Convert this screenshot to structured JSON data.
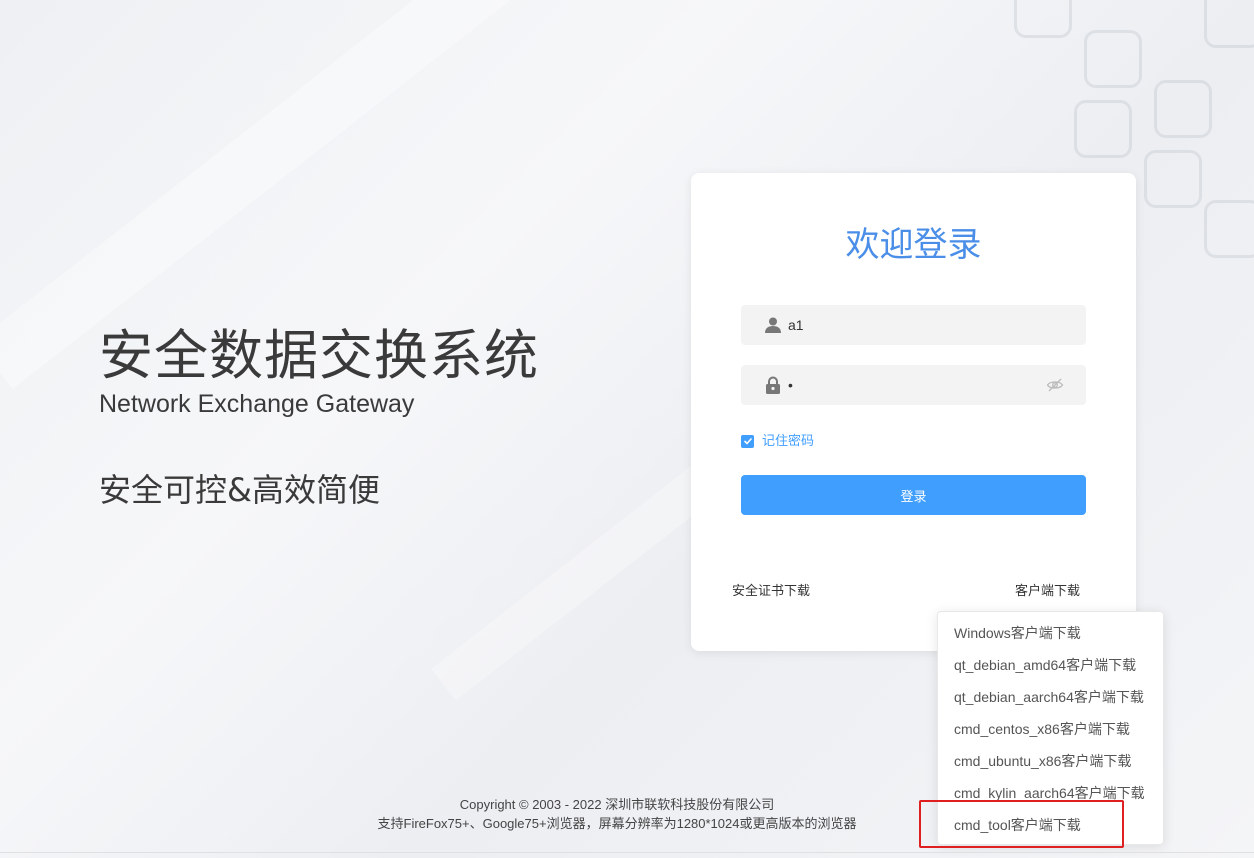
{
  "hero": {
    "title": "安全数据交换系统",
    "subtitle": "Network Exchange Gateway",
    "slogan": "安全可控&高效简便"
  },
  "login": {
    "title": "欢迎登录",
    "username_value": "a1",
    "password_value": "•",
    "remember_label": "记住密码",
    "remember_checked": true,
    "submit_label": "登录",
    "cert_download_label": "安全证书下载",
    "client_download_label": "客户端下载"
  },
  "client_menu": {
    "items": [
      "Windows客户端下载",
      "qt_debian_amd64客户端下载",
      "qt_debian_aarch64客户端下载",
      "cmd_centos_x86客户端下载",
      "cmd_ubuntu_x86客户端下载",
      "cmd_kylin_aarch64客户端下载",
      "cmd_tool客户端下载"
    ],
    "highlighted_index": 6
  },
  "footer": {
    "copyright": "Copyright © 2003 - 2022 深圳市联软科技股份有限公司",
    "browser_note": "支持FireFox75+、Google75+浏览器，屏幕分辨率为1280*1024或更高版本的浏览器"
  },
  "colors": {
    "accent": "#409eff",
    "title_blue": "#4a8ee8",
    "highlight_red": "#e02020"
  },
  "icons": {
    "username": "user-icon",
    "password": "lock-icon",
    "toggle_password": "eye-off-icon",
    "remember": "checkmark-icon"
  }
}
